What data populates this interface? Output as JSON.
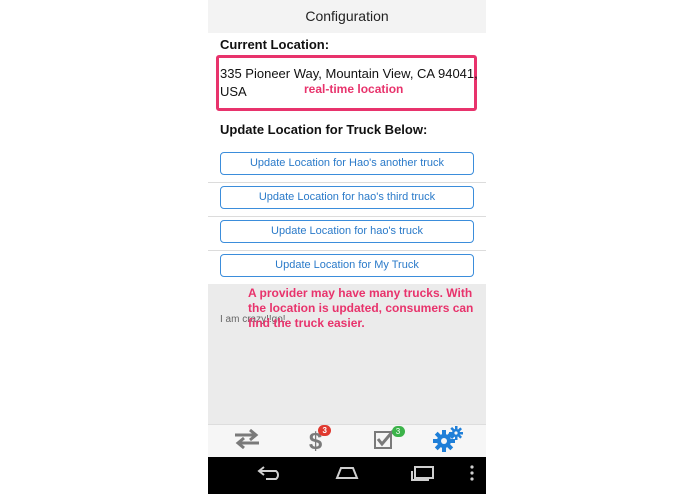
{
  "titlebar": {
    "title": "Configuration"
  },
  "current_location": {
    "label": "Current Location:",
    "address_line1": "335 Pioneer Way, Mountain View, CA 94041,",
    "address_line2": "USA",
    "annotation": "real-time location"
  },
  "update_section": {
    "label": "Update Location for Truck Below:",
    "buttons": [
      "Update Location for Hao's another truck",
      "Update Location for hao's third truck",
      "Update Location for hao's truck",
      "Update Location for My Truck"
    ]
  },
  "log": {
    "text": "I am crazy!!go!",
    "annotation": "A provider may have many trucks. With the location is updated, consumers can find the truck easier."
  },
  "tabbar": {
    "tabs": [
      {
        "icon": "swap-arrows-icon",
        "badge": ""
      },
      {
        "icon": "dollar-icon",
        "badge": "3",
        "badge_color": "#e0392f"
      },
      {
        "icon": "checkbox-icon",
        "badge": "3",
        "badge_color": "#3cb34a"
      },
      {
        "icon": "gears-icon",
        "badge": "",
        "active_color": "#1f7fd8"
      }
    ]
  },
  "colors": {
    "annotation": "#e8336c",
    "button_text": "#2a7ac9",
    "active_tab": "#1f7fd8"
  }
}
